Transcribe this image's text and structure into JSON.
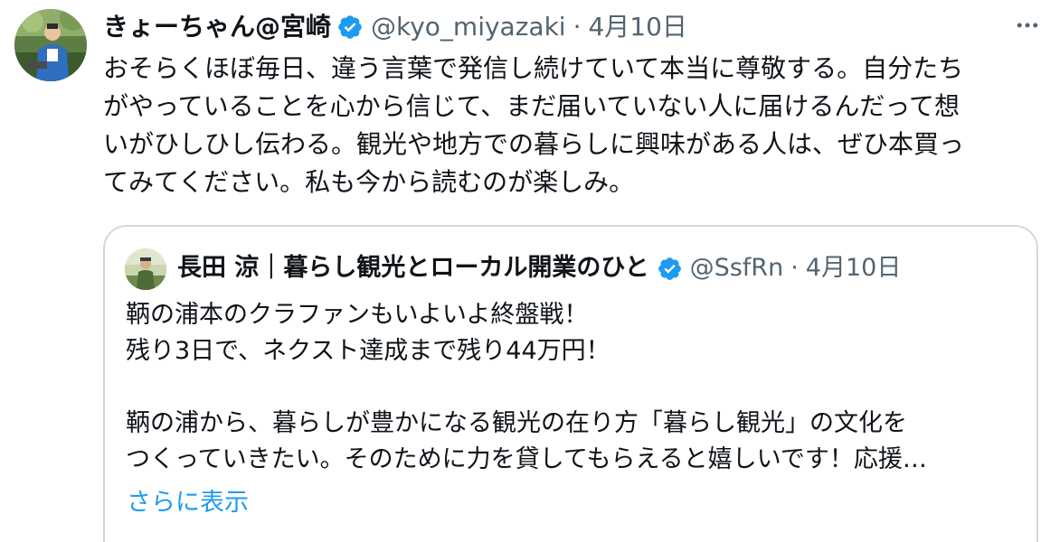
{
  "tweet": {
    "display_name": "きょーちゃん@宮崎",
    "handle": "@kyo_miyazaki",
    "separator": "·",
    "date": "4月10日",
    "text": "おそらくほぼ毎日、違う言葉で発信し続けていて本当に尊敬する。自分たち\nがやっていることを心から信じて、まだ届いていない人に届けるんだって想\nいがひしひし伝わる。観光や地方での暮らしに興味がある人は、ぜひ本買っ\nてみてください。私も今から読むのが楽しみ。"
  },
  "quoted": {
    "display_name": "長田 涼｜暮らし観光とローカル開業のひと",
    "handle": "@SsfRn",
    "separator": "·",
    "date": "4月10日",
    "text": "鞆の浦本のクラファンもいよいよ終盤戦！\n残り3日で、ネクスト達成まで残り44万円！\n\n鞆の浦から、暮らしが豊かになる観光の在り方「暮らし観光」の文化を\nつくっていきたい。そのために力を貸してもらえると嬉しいです！応援…",
    "show_more": "さらに表示"
  },
  "colors": {
    "text": "#0f1419",
    "secondary": "#536471",
    "accent": "#1d9bf0",
    "border": "#cfd9de"
  },
  "icons": {
    "verified": "verified-badge-icon",
    "more": "more-dots-icon"
  }
}
